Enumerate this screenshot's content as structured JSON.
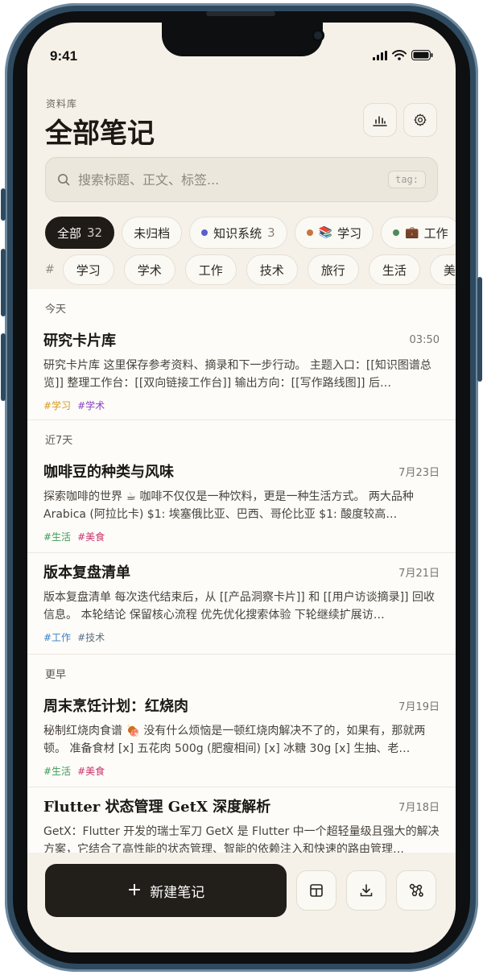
{
  "status": {
    "time": "9:41"
  },
  "header": {
    "eyebrow": "资料库",
    "title": "全部笔记"
  },
  "search": {
    "placeholder": "搜索标题、正文、标签...",
    "tag_hint": "tag:"
  },
  "filters": [
    {
      "label": "全部",
      "count": "32",
      "active": true
    },
    {
      "label": "未归档"
    },
    {
      "label": "知识系统",
      "count": "3",
      "dot": "#5b5fc7"
    },
    {
      "label": "学习",
      "emoji": "📚",
      "dot": "#c8743f"
    },
    {
      "label": "工作",
      "emoji": "💼",
      "dot": "#4f8a5a"
    }
  ],
  "tag_prefix": "#",
  "tags": [
    "学习",
    "学术",
    "工作",
    "技术",
    "旅行",
    "生活",
    "美食"
  ],
  "sections": {
    "today": "今天",
    "week": "近7天",
    "earlier": "更早"
  },
  "notes": [
    {
      "title": "研究卡片库",
      "date": "03:50",
      "body": "研究卡片库 这里保存参考资料、摘录和下一步行动。 主题入口：[[知识图谱总览]] 整理工作台：[[双向链接工作台]] 输出方向：[[写作路线图]] 后…",
      "tags": [
        {
          "text": "#学习",
          "color": "#d49a1f"
        },
        {
          "text": "#学术",
          "color": "#8a3fbf"
        }
      ]
    },
    {
      "title": "咖啡豆的种类与风味",
      "date": "7月23日",
      "body": "探索咖啡的世界 ☕ 咖啡不仅仅是一种饮料，更是一种生活方式。 两大品种 Arabica (阿拉比卡) $1: 埃塞俄比亚、巴西、哥伦比亚 $1: 酸度较高…",
      "tags": [
        {
          "text": "#生活",
          "color": "#3e9a55"
        },
        {
          "text": "#美食",
          "color": "#c8326a"
        }
      ]
    },
    {
      "title": "版本复盘清单",
      "date": "7月21日",
      "body": "版本复盘清单 每次迭代结束后，从 [[产品洞察卡片]] 和 [[用户访谈摘录]] 回收信息。 本轮结论 保留核心流程 优先优化搜索体验 下轮继续扩展访…",
      "tags": [
        {
          "text": "#工作",
          "color": "#3a7fc4"
        },
        {
          "text": "#技术",
          "color": "#5a6e80"
        }
      ]
    },
    {
      "title": "周末烹饪计划：红烧肉",
      "date": "7月19日",
      "body": "秘制红烧肉食谱 🍖 没有什么烦恼是一顿红烧肉解决不了的，如果有，那就两顿。 准备食材 [x] 五花肉 500g (肥瘦相间) [x] 冰糖 30g [x] 生抽、老…",
      "tags": [
        {
          "text": "#生活",
          "color": "#3e9a55"
        },
        {
          "text": "#美食",
          "color": "#c8326a"
        }
      ]
    },
    {
      "title": "Flutter 状态管理 GetX 深度解析",
      "date": "7月18日",
      "body": "GetX：Flutter 开发的瑞士军刀 GetX 是 Flutter 中一个超轻量级且强大的解决方案，它结合了高性能的状态管理、智能的依赖注入和快速的路由管理…",
      "tags": []
    }
  ],
  "bottom": {
    "new_label": "新建笔记",
    "plus": "+"
  }
}
